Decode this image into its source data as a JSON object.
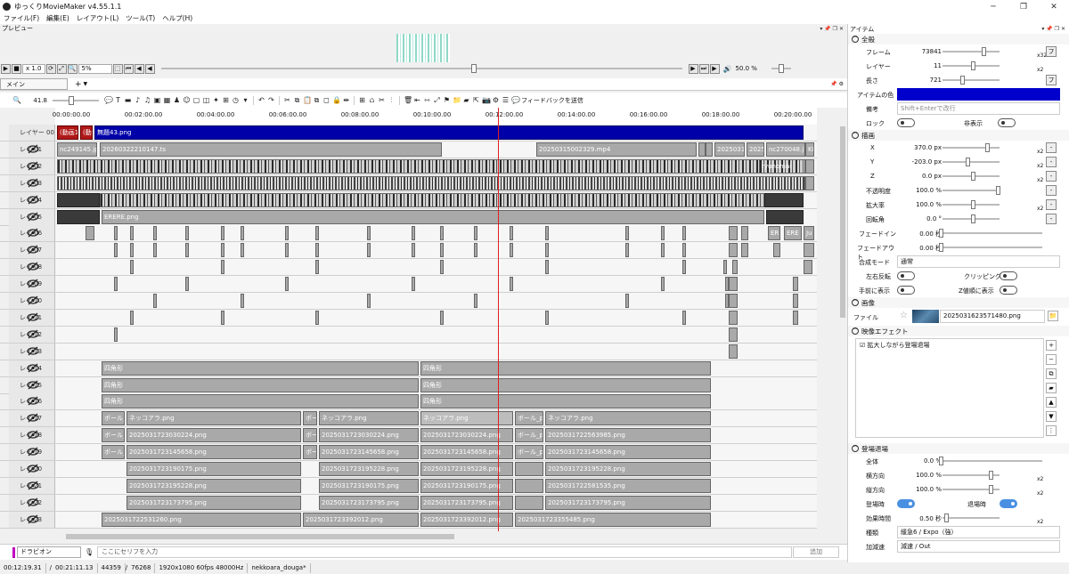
{
  "window": {
    "title": "ゆっくりMovieMaker v4.55.1.1",
    "controls": [
      "─",
      "❐",
      "✕"
    ]
  },
  "menu": [
    "ファイル(F)",
    "編集(E)",
    "レイアウト(L)",
    "ツール(T)",
    "ヘルプ(H)"
  ],
  "preview": {
    "header": "プレビュー",
    "speed": "x 1.0",
    "zoom": "5%",
    "volume": "50.0 %",
    "progress": 0.6
  },
  "timeline": {
    "tab": "メイン",
    "add": "+",
    "zoom_value": "41.8",
    "feedback": "フィードバックを送信",
    "ruler": [
      "00:00:00.00",
      "00:02:00.00",
      "00:04:00.00",
      "00:06:00.00",
      "00:08:00.00",
      "00:10:00.00",
      "00:12:00.00",
      "00:14:00.00",
      "00:16:00.00",
      "00:18:00.00",
      "00:20:00.00"
    ],
    "layers": [
      "レイヤー 00",
      "レイ 01",
      "レイ 02",
      "レイ 03",
      "レイ 04",
      "レイ 05",
      "レイ 06",
      "レイ 07",
      "レイ 08",
      "レイ 09",
      "レイ 10",
      "レイ 11",
      "レイ 12",
      "レイ 13",
      "レイ 14",
      "レイ 15",
      "レイ 16",
      "レイ 17",
      "レイ 18",
      "レイ 19",
      "レイ 20",
      "レイ 21",
      "レイ 22",
      "レイ 23"
    ],
    "clips": {
      "l0a": "(動画1",
      "l0b": "(動",
      "l0c": "無題43.png",
      "l1a": "nc249145.jpg",
      "l1b": "20260322210147.ts",
      "l1c": "20250315002329.mp4",
      "l1d": "2025031",
      "l1e": "2025",
      "l1f": "nc270048.j",
      "l1g": "Ki",
      "l2a": "ryunomai",
      "l5a": "ERERE.png",
      "l6a": "ER",
      "l6b": "ERE",
      "l6c": "Ju",
      "shikaku": "四角形",
      "l17a": "ボール_g",
      "l17b": "ネッコアラ.png",
      "l17c": "ボー",
      "l17d": "ネッコアラ.png",
      "l17e": "ネッコアラ.png",
      "l17f": "ボール_pr",
      "l17g": "ネッコアラ.png",
      "l18a": "ボール_g",
      "l18b": "20250317230302​24.png",
      "l18c": "ボー",
      "l18d": "20250317230302​24.png",
      "l18e": "20250317230302​24.png",
      "l18f": "ボール_pr",
      "l18g": "20250317225639​85.png",
      "l19a": "ボール_g",
      "l19b": "20250317231456​58.png",
      "l19c": "ボー",
      "l19d": "20250317231456​58.png",
      "l19e": "20250317231456​58.png",
      "l19f": "ボール_pr",
      "l19g": "20250317231456​58.png",
      "l20a": "20250317231901​75.png",
      "l20b": "20250317231952​28.png",
      "l20c": "20250317231952​28.png",
      "l20d": "20250317231952​28.png",
      "l21a": "20250317231952​28.png",
      "l21b": "20250317231901​75.png",
      "l21c": "20250317231901​75.png",
      "l21d": "20250317225815​35.png",
      "l22a": "20250317231737​95.png",
      "l22b": "20250317231737​95.png",
      "l22c": "20250317231737​95.png",
      "l22d": "20250317231737​95.png",
      "l23a": "20250317225312​60.png",
      "l23b": "20250317233920​12.png",
      "l23c": "20250317233920​12.png",
      "l23d": "20250317233554​85.png"
    }
  },
  "serif": {
    "character": "ドラビオン",
    "placeholder": "ここにセリフを入力",
    "add": "追加"
  },
  "status": {
    "time": "00:12:19.31",
    "total": "00:21:11.13",
    "frame": "44359",
    "total_frames": "76268",
    "format": "1920x1080 60fps 48000Hz",
    "project": "nekkoara_douga*"
  },
  "item": {
    "header": "アイテム",
    "general": {
      "title": "全般",
      "frame_label": "フレーム",
      "frame": "73841",
      "layer_label": "レイヤー",
      "layer": "11",
      "length_label": "長さ",
      "length": "721",
      "color_label": "アイテムの色",
      "color": "#0000cc",
      "note_label": "備考",
      "note_placeholder": "Shift+Enterで改行",
      "lock_label": "ロック",
      "hide_label": "非表示"
    },
    "draw": {
      "title": "描画",
      "x_label": "X",
      "x": "370.0 px",
      "y_label": "Y",
      "y": "-203.0 px",
      "z_label": "Z",
      "z": "0.0 px",
      "opacity_label": "不透明度",
      "opacity": "100.0 %",
      "scale_label": "拡大率",
      "scale": "100.0 %",
      "rotate_label": "回転角",
      "rotate": "0.0 °",
      "fadein_label": "フェードイン",
      "fadein": "0.00 秒",
      "fadeout_label": "フェードアウト",
      "fadeout": "0.00 秒",
      "blend_label": "合成モード",
      "blend": "通常",
      "flip_label": "左右反転",
      "clip_label": "クリッピング",
      "front_label": "手前に表示",
      "zorder_label": "Z値順に表示"
    },
    "image": {
      "title": "画像",
      "file_label": "ファイル",
      "file": "20250316235714​80.png"
    },
    "effects": {
      "title": "映像エフェクト",
      "list": [
        "拡大しながら登場退場"
      ]
    },
    "entrance": {
      "title": "登場退場",
      "all_label": "全体",
      "all": "0.0 %",
      "h_label": "横方向",
      "h": "100.0 %",
      "v_label": "縦方向",
      "v": "100.0 %",
      "in_label": "登場時",
      "out_label": "退場時",
      "time_label": "効果時間",
      "time": "0.50 秒",
      "type_label": "種類",
      "type": "緩急6 / Expo（強）",
      "ease_label": "加減速",
      "ease": "減速 / Out"
    }
  },
  "colors": {
    "playhead": "#e02020",
    "accent": "#0000a8",
    "toggle_on": "#4a90e2"
  }
}
